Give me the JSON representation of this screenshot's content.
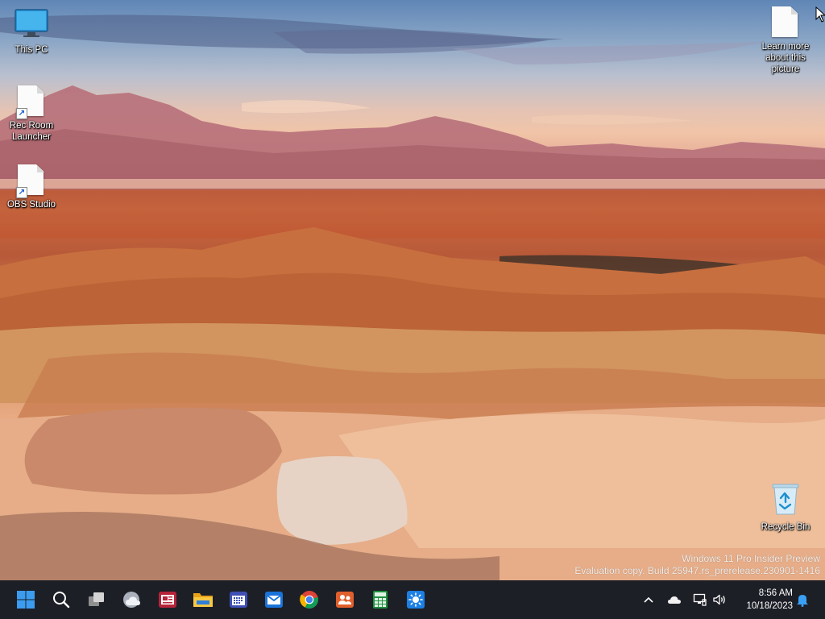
{
  "desktop": {
    "icons": [
      {
        "label": "This PC",
        "icon": "monitor-icon"
      },
      {
        "label": "Rec Room Launcher",
        "icon": "document-icon",
        "shortcut": true
      },
      {
        "label": "OBS Studio",
        "icon": "document-icon",
        "shortcut": true
      },
      {
        "label": "Learn more about this picture",
        "icon": "document-icon"
      },
      {
        "label": "Recycle Bin",
        "icon": "recycle-bin-icon"
      }
    ],
    "watermark": {
      "line1": "Windows 11 Pro Insider Preview",
      "line2": "Evaluation copy. Build 25947.rs_prerelease.230901-1416"
    }
  },
  "taskbar": {
    "pinned": [
      {
        "name": "start-button",
        "icon": "windows-logo-icon",
        "color": "#3b9cf0"
      },
      {
        "name": "search-button",
        "icon": "search-icon",
        "color": "#ffffff"
      },
      {
        "name": "task-view-button",
        "icon": "task-view-icon",
        "color": "#cfcfcf"
      },
      {
        "name": "widgets-button",
        "icon": "weather-icon",
        "color": "#d8dde6"
      },
      {
        "name": "news-app-button",
        "icon": "news-icon",
        "color": "#b7243a"
      },
      {
        "name": "file-explorer-button",
        "icon": "folder-icon",
        "color": "#f5c03b"
      },
      {
        "name": "calendar-app-button",
        "icon": "calendar-icon",
        "color": "#3f4fb4"
      },
      {
        "name": "mail-app-button",
        "icon": "mail-icon",
        "color": "#1a73d9"
      },
      {
        "name": "chrome-button",
        "icon": "chrome-icon",
        "color": "#db4437"
      },
      {
        "name": "people-app-button",
        "icon": "people-icon",
        "color": "#e0602d"
      },
      {
        "name": "calculator-app-button",
        "icon": "spreadsheet-icon",
        "color": "#1e8f3e"
      },
      {
        "name": "brightness-app-button",
        "icon": "sun-icon",
        "color": "#1c7fe3"
      }
    ],
    "tray": {
      "time": "8:56 AM",
      "date": "10/18/2023",
      "icons": [
        "chevron-up-icon",
        "onedrive-cloud-icon",
        "network-icon",
        "volume-icon",
        "notification-bell-icon"
      ]
    }
  }
}
